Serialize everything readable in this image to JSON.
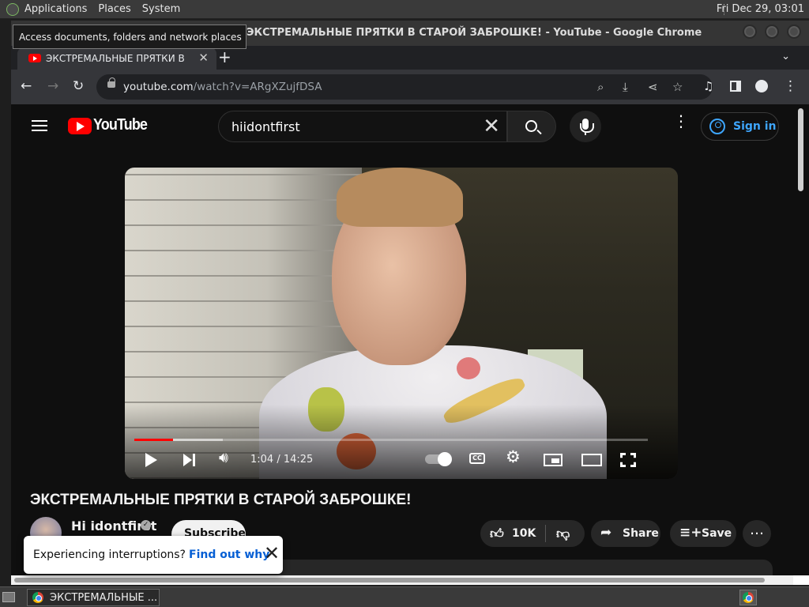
{
  "top_panel": {
    "menus": [
      "Applications",
      "Places",
      "System"
    ],
    "clock": "Fri Dec 29, 03:01"
  },
  "tooltip": "Access documents, folders and network places",
  "window": {
    "title": "ЭКСТРЕМАЛЬНЫЕ ПРЯТКИ В СТАРОЙ ЗАБРОШКЕ! - YouTube - Google Chrome"
  },
  "browser": {
    "tab_title": "ЭКСТРЕМАЛЬНЫЕ ПРЯТКИ В СТАРОЙ ЗАБРОШКЕ!",
    "url_host": "youtube.com",
    "url_path": "/watch?v=ARgXZujfDSA"
  },
  "youtube": {
    "logo_text": "YouTube",
    "search_query": "hiidontfirst",
    "sign_in": "Sign in",
    "video": {
      "time": "1:04 / 14:25",
      "progress_fraction": 0.075,
      "title": "ЭКСТРЕМАЛЬНЫЕ ПРЯТКИ В СТАРОЙ ЗАБРОШКЕ!"
    },
    "channel": {
      "name": "Hi idontfirst",
      "subscribe": "Subscribe"
    },
    "actions": {
      "likes": "10K",
      "share": "Share",
      "save": "Save"
    },
    "toast": {
      "message": "Experiencing interruptions?",
      "link": "Find out why"
    }
  },
  "taskbar": {
    "window_label": "ЭКСТРЕМАЛЬНЫЕ ..."
  }
}
